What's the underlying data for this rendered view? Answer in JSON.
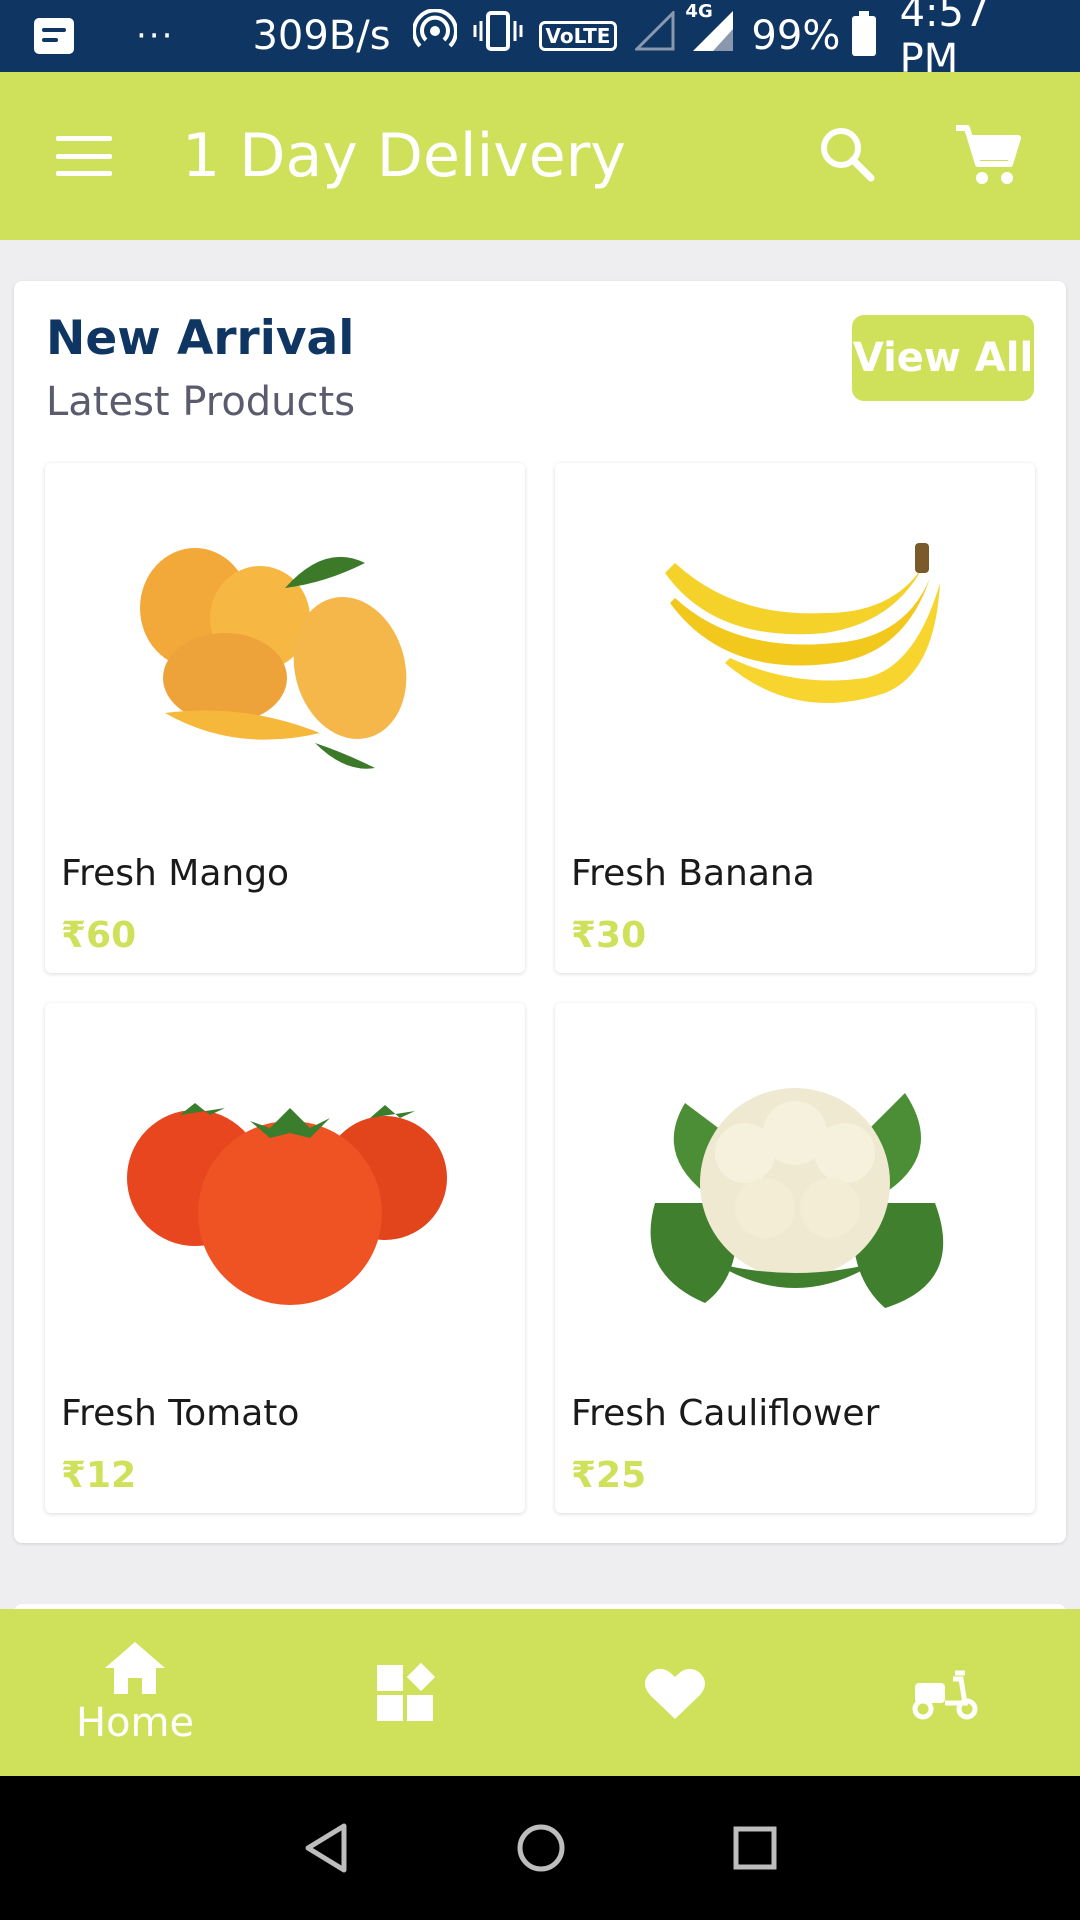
{
  "status_bar": {
    "network_speed": "309B/s",
    "dots": "···",
    "volte": "VoLTE",
    "network_type": "4G",
    "battery_percent": "99%",
    "time": "4:57 PM"
  },
  "app_bar": {
    "title": "1 Day Delivery"
  },
  "section": {
    "title": "New Arrival",
    "subtitle": "Latest Products",
    "view_all_label": "View All"
  },
  "products": [
    {
      "name": "Fresh Mango",
      "price": "₹60",
      "image": "mango"
    },
    {
      "name": "Fresh Banana",
      "price": "₹30",
      "image": "banana"
    },
    {
      "name": "Fresh Tomato",
      "price": "₹12",
      "image": "tomato"
    },
    {
      "name": "Fresh Cauliflower",
      "price": "₹25",
      "image": "cauliflower"
    }
  ],
  "bottom_nav": {
    "items": [
      {
        "label": "Home",
        "icon": "home-icon"
      },
      {
        "label": "",
        "icon": "categories-icon"
      },
      {
        "label": "",
        "icon": "heart-icon"
      },
      {
        "label": "",
        "icon": "delivery-scooter-icon"
      }
    ]
  },
  "colors": {
    "accent": "#cfe15b",
    "status_bar": "#0f3563",
    "title": "#0f3563"
  }
}
